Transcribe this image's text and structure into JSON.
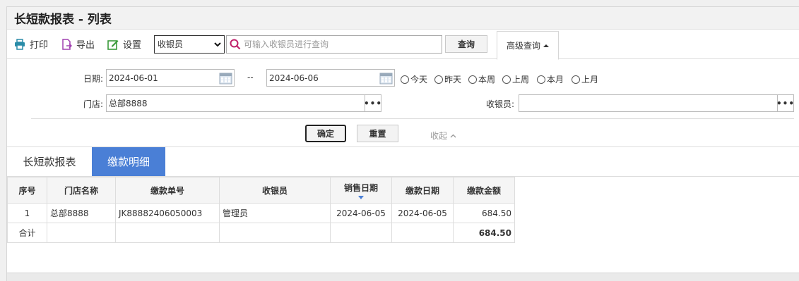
{
  "title": "长短款报表 - 列表",
  "toolbar": {
    "print_label": "打印",
    "export_label": "导出",
    "settings_label": "设置",
    "field_select": "收银员",
    "search_placeholder": "可输入收银员进行查询",
    "query_label": "查询",
    "advanced_label": "高级查询"
  },
  "filter": {
    "date_label": "日期:",
    "date_from": "2024-06-01",
    "date_sep": "--",
    "date_to": "2024-06-06",
    "quick_dates": [
      "今天",
      "昨天",
      "本周",
      "上周",
      "本月",
      "上月"
    ],
    "store_label": "门店:",
    "store_value": "总部8888",
    "cashier_label": "收银员:",
    "cashier_value": "",
    "confirm_label": "确定",
    "reset_label": "重置",
    "collapse_label": "收起"
  },
  "tabs": [
    {
      "label": "长短款报表",
      "active": false
    },
    {
      "label": "缴款明细",
      "active": true
    }
  ],
  "table": {
    "headers": [
      "序号",
      "门店名称",
      "缴款单号",
      "收银员",
      "销售日期",
      "缴款日期",
      "缴款金额"
    ],
    "rows": [
      [
        "1",
        "总部8888",
        "JK88882406050003",
        "管理员",
        "2024-06-05",
        "2024-06-05",
        "684.50"
      ]
    ],
    "total": {
      "label": "合计",
      "amount": "684.50"
    }
  },
  "colors": {
    "accent": "#4a7fd6",
    "print_icon": "#2a8ca8",
    "export_icon": "#a040b0",
    "settings_icon": "#3a9a3a",
    "search_icon": "#c0206a"
  }
}
